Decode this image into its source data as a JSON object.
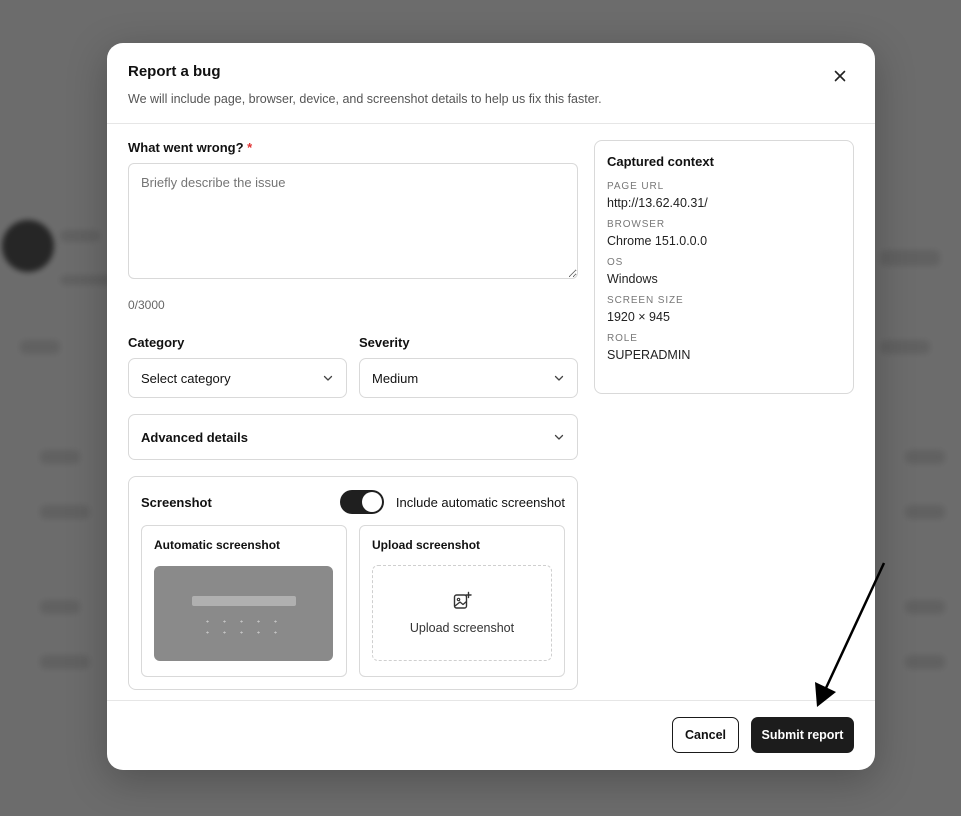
{
  "modal": {
    "title": "Report a bug",
    "subtitle": "We will include page, browser, device, and screenshot details to help us fix this faster.",
    "close_icon": "close-icon"
  },
  "form": {
    "issue_label": "What went wrong?",
    "required_mark": "*",
    "issue_placeholder": "Briefly describe the issue",
    "issue_value": "",
    "counter": "0/3000",
    "category_label": "Category",
    "category_value": "Select category",
    "severity_label": "Severity",
    "severity_value": "Medium",
    "advanced_label": "Advanced details"
  },
  "screenshot": {
    "title": "Screenshot",
    "toggle_label": "Include automatic screenshot",
    "toggle_on": true,
    "auto_title": "Automatic screenshot",
    "upload_title": "Upload screenshot",
    "upload_action": "Upload screenshot",
    "upload_icon": "image-plus-icon"
  },
  "context": {
    "title": "Captured context",
    "items": [
      {
        "key": "PAGE URL",
        "value": "http://13.62.40.31/"
      },
      {
        "key": "BROWSER",
        "value": "Chrome 151.0.0.0"
      },
      {
        "key": "OS",
        "value": "Windows"
      },
      {
        "key": "SCREEN SIZE",
        "value": "1920 × 945"
      },
      {
        "key": "ROLE",
        "value": "SUPERADMIN"
      }
    ]
  },
  "footer": {
    "cancel_label": "Cancel",
    "submit_label": "Submit report"
  },
  "colors": {
    "primary": "#1c1c1c",
    "required": "#e03131",
    "border": "#d9d9d9"
  }
}
